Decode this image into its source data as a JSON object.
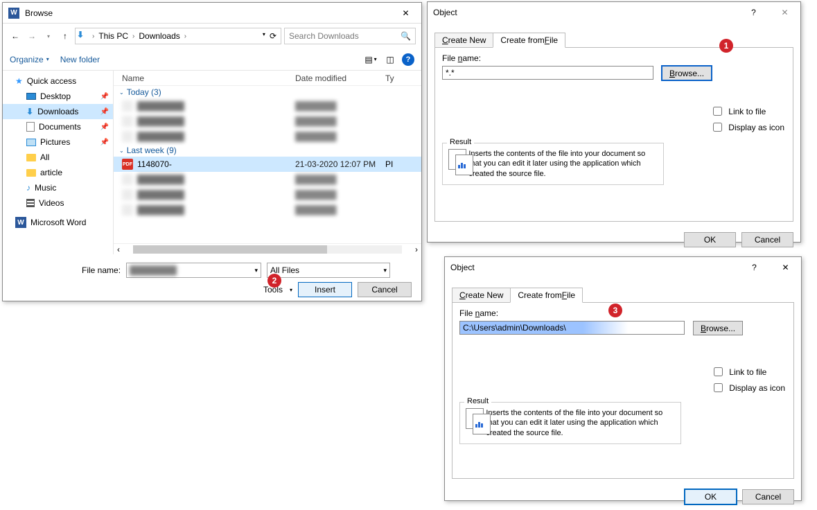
{
  "browse": {
    "title": "Browse",
    "breadcrumbs": [
      "This PC",
      "Downloads"
    ],
    "search_placeholder": "Search Downloads",
    "organize": "Organize",
    "new_folder": "New folder",
    "columns": {
      "name": "Name",
      "date": "Date modified",
      "type": "Ty"
    },
    "groups": {
      "today": "Today (3)",
      "lastweek": "Last week (9)"
    },
    "selected_file": {
      "name": "1148070-",
      "date": "21-03-2020 12:07 PM",
      "type": "PI"
    },
    "sidebar": {
      "quick": "Quick access",
      "desktop": "Desktop",
      "downloads": "Downloads",
      "documents": "Documents",
      "pictures": "Pictures",
      "all": "All",
      "article": "article",
      "music": "Music",
      "videos": "Videos",
      "msword": "Microsoft Word"
    },
    "filename_label": "File name:",
    "filter": "All Files",
    "tools": "Tools",
    "insert": "Insert",
    "cancel": "Cancel"
  },
  "object": {
    "title": "Object",
    "tab_new": "Create New",
    "tab_file_pre": "Create from ",
    "tab_file_u": "F",
    "tab_file_post": "ile",
    "filename_pre": "File ",
    "filename_u": "n",
    "filename_post": "ame:",
    "browse_u": "B",
    "browse_post": "rowse...",
    "link": "Link to file",
    "asicon": "Display as icon",
    "result": "Result",
    "resulttext": "Inserts the contents of the file into your document so that you can edit it later using the application which created the source file.",
    "ok": "OK",
    "cancel": "Cancel",
    "value1": "*.*",
    "value2": "C:\\Users\\admin\\Downloads\\"
  },
  "badges": {
    "b1": "1",
    "b2": "2",
    "b3": "3"
  }
}
